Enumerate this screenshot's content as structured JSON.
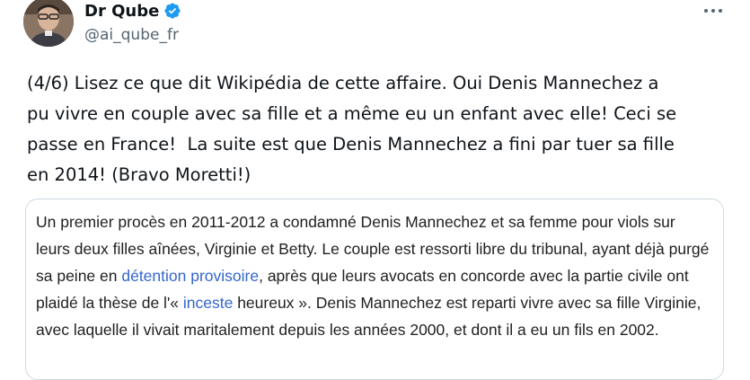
{
  "author": {
    "display_name": "Dr Qube",
    "handle": "@ai_qube_fr",
    "verified": true,
    "avatar_icon": "user-avatar"
  },
  "more_icon": "more-horizontal-icon",
  "tweet": {
    "text": "(4/6) Lisez ce que dit Wikipédia de cette affaire. Oui Denis Mannechez a\npu vivre en couple avec sa fille et a même eu un enfant avec elle! Ceci se\npasse en France!  La suite est que Denis Mannechez a fini par tuer sa fille\nen 2014! (Bravo Moretti!)"
  },
  "quote": {
    "part1": "Un premier procès en 2011-2012 a condamné Denis Mannechez et sa femme pour viols sur leurs deux filles aînées, Virginie et Betty. Le couple est ressorti libre du tribunal, ayant déjà purgé sa peine en ",
    "link1": "détention provisoire",
    "part2": ", après que leurs avocats en concorde avec la partie civile ont plaidé la thèse de l'« ",
    "link2": "inceste",
    "part3": " heureux ». Denis Mannechez est reparti vivre avec sa fille Virginie, avec laquelle il vivait maritalement depuis les années 2000, et dont il a eu un fils en 2002."
  },
  "colors": {
    "verified_badge": "#1d9bf0",
    "wiki_link": "#3366cc",
    "secondary_text": "#536471",
    "border": "#cfd9de"
  }
}
